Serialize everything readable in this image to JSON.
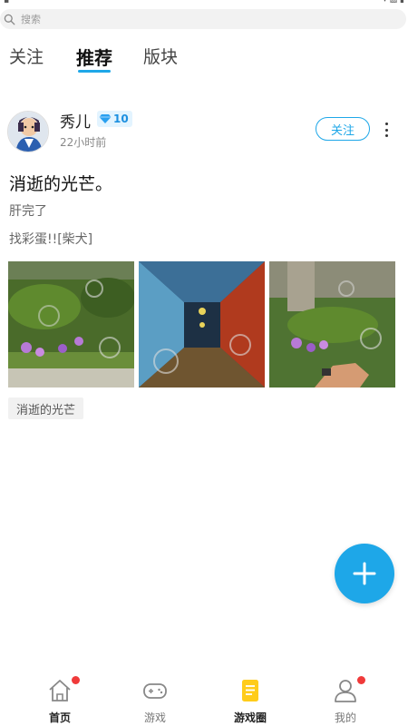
{
  "search": {
    "placeholder": "搜索"
  },
  "tabs": [
    {
      "label": "关注"
    },
    {
      "label": "推荐"
    },
    {
      "label": "版块"
    }
  ],
  "post": {
    "author": "秀儿",
    "level": "10",
    "time": "22小时前",
    "follow_label": "关注",
    "title": "消逝的光芒。",
    "line1": "肝完了",
    "line2": "找彩蛋!![柴犬]",
    "tag": "消逝的光芒"
  },
  "bottom_nav": [
    {
      "label": "首页",
      "icon": "home-icon",
      "badge": true
    },
    {
      "label": "游戏",
      "icon": "gamepad-icon",
      "badge": false
    },
    {
      "label": "游戏圈",
      "icon": "document-icon",
      "badge": false
    },
    {
      "label": "我的",
      "icon": "user-icon",
      "badge": true
    }
  ],
  "colors": {
    "accent": "#1ea7e8",
    "badge": "#f03a3a",
    "active_nav_icon": "#ffcc1a"
  }
}
